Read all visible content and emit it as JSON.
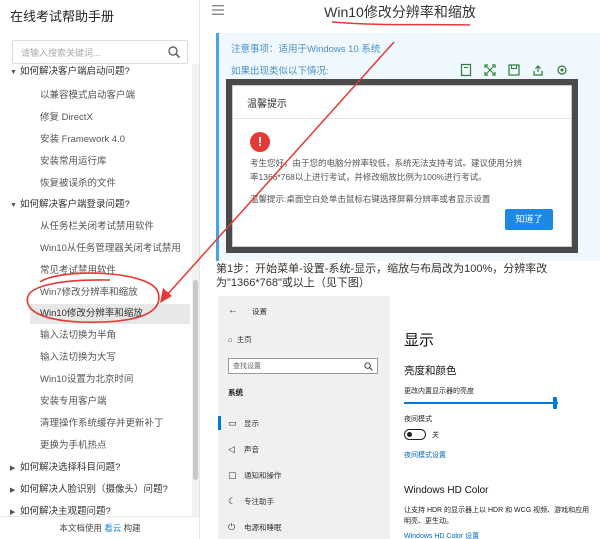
{
  "sidebar": {
    "title": "在线考试帮助手册",
    "search_placeholder": "请输入搜索关键词...",
    "items": [
      {
        "label": "如何解决客户端启动问题?",
        "kind": "group",
        "open": true
      },
      {
        "label": "以兼容模式启动客户端",
        "kind": "sub"
      },
      {
        "label": "修复 DirectX",
        "kind": "sub"
      },
      {
        "label": "安装 Framework 4.0",
        "kind": "sub"
      },
      {
        "label": "安装常用运行库",
        "kind": "sub"
      },
      {
        "label": "恢复被误杀的文件",
        "kind": "sub"
      },
      {
        "label": "如何解决客户端登录问题?",
        "kind": "group",
        "open": true
      },
      {
        "label": "从任务栏关闭考试禁用软件",
        "kind": "sub"
      },
      {
        "label": "Win10从任务管理器关闭考试禁用",
        "kind": "sub"
      },
      {
        "label": "常见考试禁用软件",
        "kind": "sub"
      },
      {
        "label": "Win7修改分辨率和缩放",
        "kind": "sub"
      },
      {
        "label": "Win10修改分辨率和缩放",
        "kind": "active"
      },
      {
        "label": "输入法切换为半角",
        "kind": "sub"
      },
      {
        "label": "输入法切换为大写",
        "kind": "sub"
      },
      {
        "label": "Win10设置为北京时间",
        "kind": "sub"
      },
      {
        "label": "安装专用客户端",
        "kind": "sub"
      },
      {
        "label": "清理操作系统缓存并更新补丁",
        "kind": "sub"
      },
      {
        "label": "更换为手机热点",
        "kind": "sub"
      },
      {
        "label": "如何解决选择科目问题?",
        "kind": "group",
        "open": false
      },
      {
        "label": "如何解决人脸识别（摄像头）问题?",
        "kind": "group",
        "open": false
      },
      {
        "label": "如何解决主观题问题?",
        "kind": "group",
        "open": false
      }
    ],
    "footer_prefix": "本文档使用 ",
    "footer_brand": "看云",
    "footer_suffix": " 构建"
  },
  "page": {
    "title": "Win10修改分辨率和缩放"
  },
  "notice": {
    "line1": "注意事项：适用于Windows 10 系统",
    "line2": "如果出现类似以下情况:"
  },
  "dialog": {
    "title": "温馨提示",
    "text1": "考生您好，由于您的电脑分辨率较低，系统无法支持考试。建议使用分辨",
    "text2": "率1366*768以上进行考试，并修改缩放比例为100%进行考试。",
    "text3": "温馨提示:桌面空白处单击鼠标右键选择屏幕分辨率或者显示设置",
    "button": "知道了"
  },
  "step": {
    "text": "第1步：开始菜单-设置-系统-显示，缩放与布局改为100%，分辨率改为\"1366*768\"或以上（见下图）"
  },
  "win_settings": {
    "app_title": "设置",
    "home": "主页",
    "search_placeholder": "查找设置",
    "section": "系统",
    "nav": [
      {
        "icon": "monitor-icon",
        "glyph": "▭",
        "label": "显示",
        "selected": true
      },
      {
        "icon": "sound-icon",
        "glyph": "◁",
        "label": "声音",
        "selected": false
      },
      {
        "icon": "notification-icon",
        "glyph": "▢",
        "label": "通知和操作",
        "selected": false
      },
      {
        "icon": "moon-icon",
        "glyph": "☾",
        "label": "专注助手",
        "selected": false
      },
      {
        "icon": "power-icon",
        "glyph": "⏻",
        "label": "电源和睡眠",
        "selected": false
      }
    ],
    "heading": "显示",
    "subheading": "亮度和颜色",
    "brightness_label": "更改内置显示器的亮度",
    "night_label": "夜间模式",
    "night_state": "关",
    "night_link": "夜间模式设置",
    "hd_title": "Windows HD Color",
    "hd_desc1": "让支持 HDR 的显示器上以 HDR 和 WCG 视频、游戏和应用",
    "hd_desc2": "明亮、更生动。",
    "hd_link": "Windows HD Color 设置"
  },
  "colors": {
    "accent": "#1e88e5",
    "annotation": "#e53935",
    "windows_blue": "#0078d7"
  }
}
